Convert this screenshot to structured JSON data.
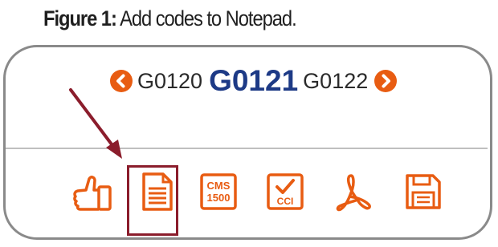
{
  "caption": {
    "label": "Figure 1:",
    "text": " Add codes to Notepad."
  },
  "nav": {
    "prev_code": "G0120",
    "current_code": "G0121",
    "next_code": "G0122"
  },
  "toolbar": {
    "cms_line1": "CMS",
    "cms_line2": "1500",
    "cci_label": "CCI"
  },
  "colors": {
    "accent": "#e85c12",
    "current_code": "#1d3a86",
    "highlight": "#8b1d2c",
    "frame": "#8a8a8a"
  },
  "icons": [
    "chevron-left-icon",
    "chevron-right-icon",
    "thumbs-up-icon",
    "notepad-icon",
    "cms-1500-icon",
    "cci-icon",
    "pdf-icon",
    "save-icon"
  ]
}
